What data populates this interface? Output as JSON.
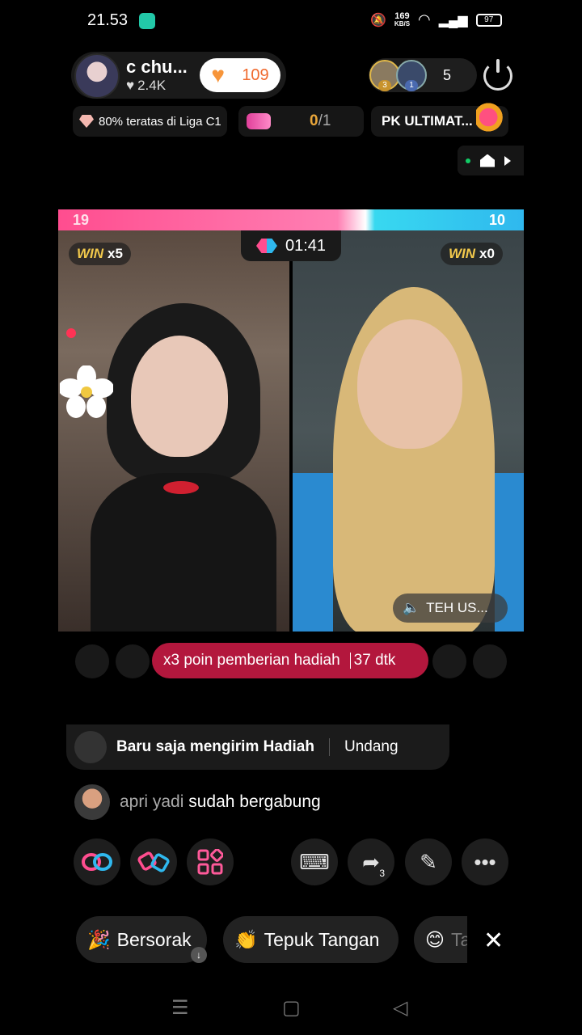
{
  "status_bar": {
    "time": "21.53",
    "net_speed": "169",
    "net_unit": "KB/S",
    "battery": "97"
  },
  "host": {
    "name": "c chu...",
    "likes": "2.4K",
    "follow_count": "109"
  },
  "viewers": {
    "badge1": "3",
    "badge2": "1",
    "count": "5"
  },
  "chips": {
    "league": "80% teratas di Liga C1",
    "progress_done": "0",
    "progress_total": "/1",
    "pk_label": "PK ULTIMAT..."
  },
  "pk": {
    "left_score": "19",
    "right_score": "10",
    "timer": "01:41",
    "left_win_label": "WIN",
    "left_win_count": "x5",
    "right_win_label": "WIN",
    "right_win_count": "x0",
    "right_audio_label": "TEH US..."
  },
  "boost": {
    "text": "x3 poin pemberian hadiah",
    "timer": "37 dtk"
  },
  "comments": {
    "gift_text": "Baru saja mengirim Hadiah",
    "invite": "Undang",
    "join_user": "apri yadi",
    "join_text": "sudah bergabung"
  },
  "tools": {
    "share_count": "3"
  },
  "reactions": [
    {
      "label": "Bersorak"
    },
    {
      "label": "Tepuk Tangan"
    },
    {
      "label": "Ta"
    }
  ],
  "colors": {
    "pk_pink": "#ff4d8f",
    "pk_blue": "#2fb8ee",
    "boost_red": "#b3173d",
    "follow_orange": "#f06a2e"
  }
}
